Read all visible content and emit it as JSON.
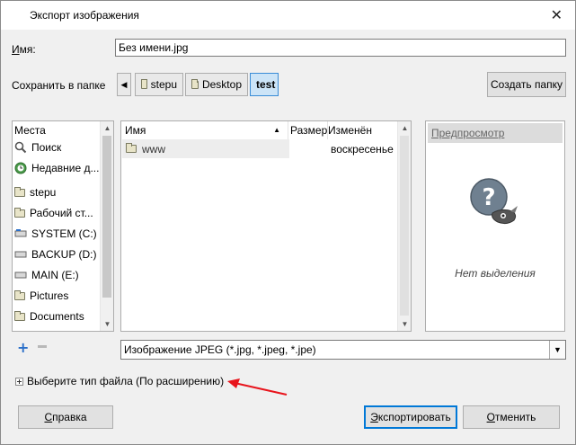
{
  "window": {
    "title": "Экспорт изображения",
    "close_label": "✕"
  },
  "name_row": {
    "label": "Имя:",
    "value": "Без имени.jpg"
  },
  "folder_row": {
    "label": "Сохранить в папке",
    "back_arrow": "◀",
    "crumbs": [
      "stepu",
      "Desktop",
      "test"
    ],
    "create_folder_label": "Создать папку"
  },
  "places": {
    "header": "Места",
    "items": [
      {
        "label": "Поиск",
        "icon": "search-icon"
      },
      {
        "label": "Недавние д...",
        "icon": "recent-icon"
      },
      {
        "label": "stepu",
        "icon": "folder-icon"
      },
      {
        "label": "Рабочий ст...",
        "icon": "folder-icon"
      },
      {
        "label": "SYSTEM (C:)",
        "icon": "drive-icon"
      },
      {
        "label": "BACKUP (D:)",
        "icon": "drive-icon"
      },
      {
        "label": "MAIN (E:)",
        "icon": "drive-icon"
      },
      {
        "label": "Pictures",
        "icon": "folder-icon"
      },
      {
        "label": "Documents",
        "icon": "folder-icon"
      }
    ],
    "add_label": "+",
    "remove_label": ""
  },
  "files": {
    "columns": {
      "name": "Имя",
      "size": "Размер",
      "modified": "Изменён"
    },
    "sort_indicator": "▲",
    "rows": [
      {
        "name": "www",
        "size": "",
        "modified": "воскресенье"
      }
    ]
  },
  "preview": {
    "title": "Предпросмотр",
    "empty_text": "Нет выделения"
  },
  "filter": {
    "value": "Изображение JPEG (*.jpg, *.jpeg, *.jpe)",
    "dropdown_arrow": "▼"
  },
  "filetype_expander": {
    "label": "Выберите тип файла (По расширению)"
  },
  "buttons": {
    "help": {
      "prefix": "",
      "underlined": "С",
      "rest": "правка"
    },
    "export": {
      "underlined": "Э",
      "rest": "кспортировать"
    },
    "cancel": {
      "underlined": "О",
      "rest": "тменить"
    }
  },
  "colors": {
    "accent": "#0078d7",
    "annotation_arrow": "#e8141c",
    "selected_crumb": "#cce4f7"
  }
}
